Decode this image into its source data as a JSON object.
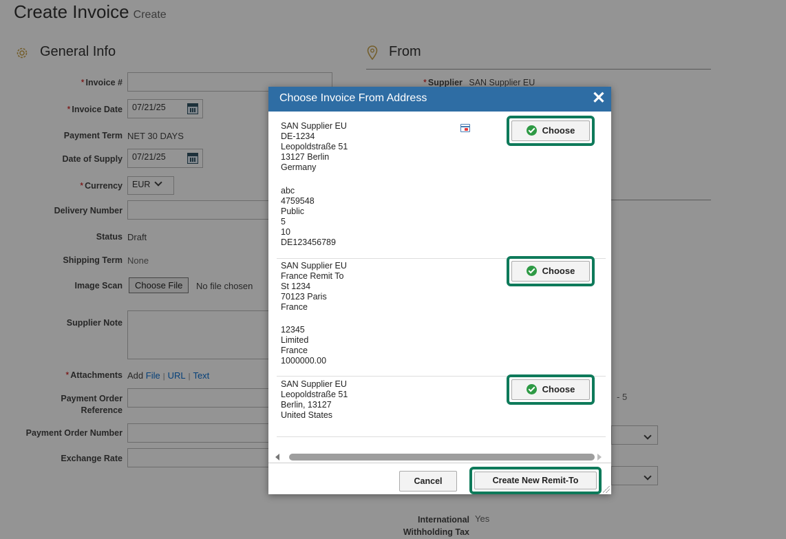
{
  "page": {
    "title": "Create Invoice",
    "subtitle": "Create"
  },
  "general_info": {
    "title": "General Info",
    "fields": {
      "invoice_no_label": "Invoice #",
      "invoice_date_label": "Invoice Date",
      "invoice_date_value": "07/21/25",
      "payment_term_label": "Payment Term",
      "payment_term_value": "NET 30 DAYS",
      "date_of_supply_label": "Date of Supply",
      "date_of_supply_value": "07/21/25",
      "currency_label": "Currency",
      "currency_value": "EUR",
      "delivery_number_label": "Delivery Number",
      "status_label": "Status",
      "status_value": "Draft",
      "shipping_term_label": "Shipping Term",
      "shipping_term_value": "None",
      "image_scan_label": "Image Scan",
      "choose_file_label": "Choose File",
      "no_file_text": "No file chosen",
      "supplier_note_label": "Supplier Note",
      "attachments_label": "Attachments",
      "attachments_add": "Add",
      "attachments_file": "File",
      "attachments_url": "URL",
      "attachments_text": "Text",
      "attachments_sep": "|",
      "payment_order_ref_label_1": "Payment Order",
      "payment_order_ref_label_2": "Reference",
      "payment_order_number_label": "Payment Order Number",
      "exchange_rate_label": "Exchange Rate"
    }
  },
  "from": {
    "title": "From",
    "supplier_label": "Supplier",
    "supplier_value": "SAN Supplier EU",
    "partial_value": "- 5",
    "withholding_label_1": "International",
    "withholding_label_2": "Withholding Tax",
    "withholding_value": "Yes"
  },
  "modal": {
    "title": "Choose Invoice From Address",
    "close_glyph": "✕",
    "choose_label": "Choose",
    "addresses": [
      {
        "lines": "SAN Supplier EU\nDE-1234\nLeopoldstraße 51\n13127 Berlin\nGermany",
        "extra": "abc\n4759548\nPublic\n5\n10\nDE123456789"
      },
      {
        "lines": "SAN Supplier EU\nFrance Remit To\nSt 1234\n70123 Paris\nFrance",
        "extra": "12345\nLimited\nFrance\n1000000.00"
      },
      {
        "lines": "SAN Supplier EU\nLeopoldstraße 51\nBerlin, 13127\nUnited States",
        "extra": ""
      }
    ],
    "cancel_label": "Cancel",
    "create_label": "Create New Remit-To"
  },
  "icons": [
    "gear-icon",
    "location-pin-icon",
    "calendar-icon",
    "chevron-down-icon",
    "close-icon",
    "check-circle-icon",
    "card-icon"
  ],
  "colors": {
    "modal_header": "#2e6da4",
    "highlight": "#0e7a5a",
    "check": "#2e9a45",
    "link": "#0a6ed1",
    "required": "#cc0000"
  }
}
